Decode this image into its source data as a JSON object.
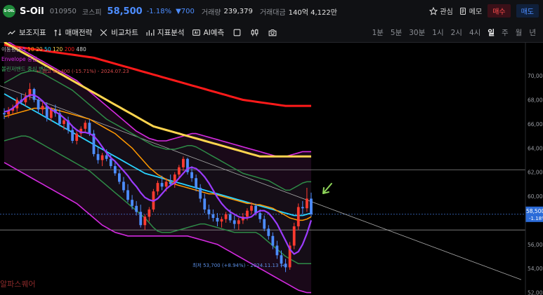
{
  "header": {
    "logo_text": "S-OIL",
    "name": "S-Oil",
    "code": "010950",
    "market": "코스피",
    "price": "58,500",
    "change_pct": "-1.18%",
    "change_abs": "▼700",
    "volume_label": "거래량",
    "volume": "239,379",
    "amount_label": "거래대금",
    "amount": "140억 4,122만",
    "watch": "관심",
    "memo": "메모",
    "buy": "매수",
    "sell": "매도"
  },
  "toolbar": {
    "items": [
      "보조지표",
      "매매전략",
      "비교차트",
      "지표분석",
      "AI예측"
    ],
    "periods": [
      "1분",
      "5분",
      "30분",
      "1시",
      "2시",
      "4시",
      "일",
      "주",
      "월",
      "년"
    ],
    "active_period": "일"
  },
  "legend": {
    "ma_label": "이동평균",
    "ma_periods": [
      "5",
      "10",
      "20",
      "50",
      "120",
      "200",
      "480"
    ],
    "line2": "Envelope 중심",
    "line3": "볼린저밴드 중심 밴드"
  },
  "annotations": {
    "high": "← 최고 69,400 (-15.71%) - 2024.07.23",
    "low": "최저 53,700 (+8.94%) - 2024.11.13 →"
  },
  "price_tag": {
    "price": "58,500",
    "pct": "-1.18%"
  },
  "watermark": "알파스퀘어",
  "colors": {
    "up": "#ff3b30",
    "down": "#4d8dff",
    "ma5": "#9c3cff",
    "ma10": "#ff9800",
    "ma20": "#2ad4ff",
    "ma50": "#ffd54f",
    "ma200": "#ff1a1a",
    "ma480": "#d2d2d2",
    "bb": "#2e8b47",
    "envelope": "#d42ae0"
  },
  "chart_data": {
    "type": "candlestick",
    "y_range": [
      51800,
      72800
    ],
    "y_ticks": [
      "70,000",
      "68,000",
      "66,000",
      "64,000",
      "62,000",
      "60,000",
      "56,000",
      "54,000",
      "52,000"
    ],
    "y_tick_values": [
      70000,
      68000,
      66000,
      64000,
      62000,
      60000,
      56000,
      54000,
      52000
    ],
    "last_price": 58500,
    "reference_lines": [
      62200,
      57200
    ],
    "trendline": {
      "from": [
        0,
        68700
      ],
      "to": [
        1,
        54000
      ]
    },
    "candles": [
      [
        66900,
        67300,
        66400,
        66800
      ],
      [
        66800,
        67400,
        66500,
        67100
      ],
      [
        67100,
        67600,
        66800,
        67300
      ],
      [
        67300,
        68200,
        67000,
        68000
      ],
      [
        68000,
        68500,
        67600,
        67800
      ],
      [
        67800,
        68600,
        67500,
        68300
      ],
      [
        68300,
        69400,
        68000,
        68900
      ],
      [
        68900,
        69000,
        67800,
        68000
      ],
      [
        68000,
        68100,
        66900,
        67200
      ],
      [
        67200,
        67800,
        66800,
        67500
      ],
      [
        67500,
        67800,
        66200,
        66500
      ],
      [
        66500,
        67400,
        66200,
        67200
      ],
      [
        67200,
        67600,
        66600,
        66900
      ],
      [
        66900,
        67200,
        65800,
        66000
      ],
      [
        66000,
        66500,
        65500,
        66300
      ],
      [
        66300,
        66600,
        65200,
        65500
      ],
      [
        65500,
        65900,
        64400,
        64600
      ],
      [
        64600,
        65400,
        64300,
        65200
      ],
      [
        65200,
        65800,
        64900,
        65600
      ],
      [
        65600,
        66300,
        65300,
        66100
      ],
      [
        66100,
        66400,
        65000,
        65200
      ],
      [
        65200,
        65500,
        63300,
        63500
      ],
      [
        63500,
        64100,
        62700,
        63000
      ],
      [
        63000,
        63600,
        62500,
        63400
      ],
      [
        63400,
        63900,
        62900,
        63100
      ],
      [
        63100,
        63500,
        62300,
        62500
      ],
      [
        62500,
        62900,
        61700,
        61900
      ],
      [
        61900,
        62200,
        61000,
        61200
      ],
      [
        61200,
        61600,
        60300,
        60500
      ],
      [
        60500,
        61000,
        59500,
        59700
      ],
      [
        59700,
        60100,
        58900,
        59200
      ],
      [
        59200,
        59600,
        58400,
        58700
      ],
      [
        58700,
        59300,
        57400,
        57600
      ],
      [
        57600,
        58500,
        57200,
        58300
      ],
      [
        58300,
        59100,
        57900,
        58900
      ],
      [
        58900,
        60600,
        58700,
        60400
      ],
      [
        60400,
        61300,
        60100,
        61100
      ],
      [
        61100,
        61700,
        60500,
        60800
      ],
      [
        60800,
        61500,
        60400,
        61200
      ],
      [
        61200,
        61800,
        60800,
        61000
      ],
      [
        61000,
        62000,
        60700,
        61800
      ],
      [
        61800,
        62600,
        61500,
        62400
      ],
      [
        62400,
        63300,
        62100,
        63100
      ],
      [
        63100,
        63200,
        61800,
        62000
      ],
      [
        62000,
        62500,
        61200,
        61500
      ],
      [
        61500,
        61800,
        60400,
        60700
      ],
      [
        60700,
        61000,
        59500,
        59800
      ],
      [
        59800,
        60200,
        58600,
        58900
      ],
      [
        58900,
        59300,
        58100,
        58500
      ],
      [
        58500,
        58900,
        57900,
        58200
      ],
      [
        58200,
        58600,
        57500,
        57900
      ],
      [
        57900,
        58300,
        57400,
        58100
      ],
      [
        58100,
        58700,
        57800,
        58500
      ],
      [
        58500,
        58900,
        57800,
        58000
      ],
      [
        58000,
        58400,
        57300,
        57700
      ],
      [
        57700,
        58200,
        57200,
        58000
      ],
      [
        58000,
        58600,
        57700,
        58300
      ],
      [
        58300,
        59000,
        58000,
        58800
      ],
      [
        58800,
        59500,
        58500,
        59200
      ],
      [
        59200,
        59400,
        58400,
        58600
      ],
      [
        58600,
        58900,
        57800,
        58100
      ],
      [
        58100,
        58400,
        57100,
        57300
      ],
      [
        57300,
        57600,
        56400,
        56700
      ],
      [
        56700,
        57000,
        55600,
        55900
      ],
      [
        55900,
        56300,
        54800,
        55100
      ],
      [
        55100,
        55500,
        54100,
        54400
      ],
      [
        54400,
        54800,
        53700,
        54100
      ],
      [
        54100,
        56200,
        53900,
        55900
      ],
      [
        55900,
        57800,
        55600,
        57500
      ],
      [
        57500,
        59400,
        57200,
        59100
      ],
      [
        59100,
        59600,
        58500,
        59000
      ],
      [
        59000,
        60700,
        58700,
        59800
      ],
      [
        59800,
        60300,
        58300,
        58500
      ]
    ],
    "moving_averages": {
      "ma5": [
        67000,
        67100,
        67300,
        67600,
        67900,
        68200,
        68400,
        68400,
        68200,
        67900,
        67500,
        67200,
        67000,
        66800,
        66500,
        66200,
        65800,
        65500,
        65300,
        65300,
        65200,
        65000,
        64600,
        64100,
        63600,
        63200,
        62900,
        62500,
        62100,
        61700,
        61200,
        60800,
        60300,
        59900,
        59700,
        59600,
        59800,
        60200,
        60600,
        60900,
        61100,
        61500,
        61900,
        62300,
        62400,
        62300,
        62000,
        61600,
        61100,
        60500,
        59900,
        59400,
        59000,
        58700,
        58500,
        58300,
        58200,
        58200,
        58300,
        58600,
        58800,
        58800,
        58600,
        58200,
        57700,
        57000,
        56300,
        55600,
        55200,
        55400,
        56000,
        56900,
        58000
      ],
      "ma20": [
        66600,
        66700,
        66800,
        66900,
        67000,
        67100,
        67200,
        67300,
        67300,
        67300,
        67300,
        67300,
        67200,
        67100,
        67000,
        66900,
        66800,
        66700,
        66600,
        66500,
        66400,
        66200,
        66000,
        65800,
        65600,
        65400,
        65200,
        64900,
        64600,
        64300,
        64000,
        63600,
        63200,
        62800,
        62400,
        62100,
        61800,
        61600,
        61400,
        61200,
        61000,
        60900,
        60800,
        60700,
        60600,
        60500,
        60400,
        60300,
        60200,
        60200,
        60100,
        60000,
        59900,
        59800,
        59700,
        59600,
        59500,
        59400,
        59400,
        59300,
        59300,
        59200,
        59100,
        59000,
        58800,
        58600,
        58400,
        58200,
        58100,
        58000,
        58000,
        58100,
        58300
      ],
      "ma50": [
        68500,
        68300,
        68100,
        67900,
        67700,
        67500,
        67300,
        67100,
        66900,
        66700,
        66500,
        66300,
        66100,
        65900,
        65700,
        65500,
        65300,
        65100,
        64900,
        64700,
        64500,
        64300,
        64100,
        63900,
        63700,
        63500,
        63300,
        63100,
        62900,
        62700,
        62500,
        62300,
        62100,
        61900,
        61800,
        61700,
        61600,
        61500,
        61400,
        61300,
        61200,
        61100,
        61000,
        60900,
        60800,
        60700,
        60600,
        60500,
        60400,
        60300,
        60200,
        60100,
        60000,
        59900,
        59800,
        59700,
        59600,
        59500,
        59400,
        59300,
        59200,
        59100,
        59000,
        58900,
        58800,
        58700,
        58600,
        58500,
        58400,
        58400,
        58400,
        58500,
        58600
      ],
      "ma120": [
        72800,
        72600,
        72400,
        72200,
        72000,
        71800,
        71600,
        71400,
        71200,
        71000,
        70800,
        70600,
        70400,
        70200,
        70000,
        69800,
        69600,
        69400,
        69200,
        69000,
        68800,
        68600,
        68400,
        68200,
        68000,
        67800,
        67600,
        67400,
        67200,
        67000,
        66800,
        66600,
        66400,
        66200,
        66000,
        65800,
        65700,
        65600,
        65500,
        65400,
        65300,
        65200,
        65100,
        65000,
        64900,
        64800,
        64700,
        64600,
        64500,
        64400,
        64300,
        64200,
        64100,
        64000,
        63900,
        63800,
        63700,
        63600,
        63500,
        63400,
        63300,
        63300,
        63300,
        63300,
        63300,
        63300,
        63300,
        63300,
        63300,
        63300,
        63300,
        63300,
        63300
      ],
      "ma200": [
        72600,
        72500,
        72450,
        72400,
        72350,
        72300,
        72250,
        72200,
        72150,
        72100,
        72050,
        72000,
        71950,
        71900,
        71850,
        71800,
        71750,
        71700,
        71650,
        71600,
        71550,
        71500,
        71400,
        71300,
        71200,
        71100,
        71000,
        70900,
        70800,
        70700,
        70600,
        70500,
        70400,
        70300,
        70200,
        70100,
        70000,
        69900,
        69800,
        69700,
        69600,
        69500,
        69400,
        69300,
        69200,
        69100,
        69000,
        68900,
        68800,
        68700,
        68600,
        68500,
        68400,
        68300,
        68200,
        68100,
        68000,
        67950,
        67900,
        67850,
        67800,
        67750,
        67700,
        67650,
        67600,
        67550,
        67500,
        67500,
        67500,
        67500,
        67500,
        67500,
        67500
      ]
    },
    "bollinger": {
      "upper": [
        69400,
        69600,
        69800,
        70000,
        70200,
        70300,
        70400,
        70400,
        70300,
        70200,
        70000,
        69800,
        69600,
        69400,
        69200,
        69000,
        68800,
        68500,
        68200,
        67900,
        67600,
        67300,
        67000,
        66700,
        66400,
        66200,
        66000,
        65800,
        65600,
        65400,
        65200,
        65000,
        64800,
        64600,
        64400,
        64200,
        64100,
        64000,
        63900,
        63900,
        63900,
        64000,
        64100,
        64200,
        64200,
        64100,
        63900,
        63700,
        63500,
        63300,
        63100,
        62900,
        62700,
        62500,
        62300,
        62100,
        61900,
        61800,
        61700,
        61600,
        61500,
        61400,
        61300,
        61100,
        60900,
        60700,
        60500,
        60500,
        60700,
        60900,
        61100,
        61200,
        61200
      ],
      "lower": [
        64600,
        64700,
        64800,
        64900,
        65000,
        65000,
        64900,
        64700,
        64500,
        64300,
        64100,
        63900,
        63700,
        63500,
        63300,
        63100,
        62900,
        62700,
        62500,
        62300,
        62100,
        61800,
        61500,
        61200,
        60900,
        60600,
        60300,
        60000,
        59700,
        59400,
        59100,
        58800,
        58500,
        58200,
        57800,
        57400,
        57100,
        57000,
        57000,
        57000,
        57100,
        57200,
        57300,
        57400,
        57500,
        57600,
        57700,
        57700,
        57600,
        57500,
        57400,
        57300,
        57200,
        57100,
        57000,
        57000,
        57000,
        57000,
        57000,
        57000,
        56800,
        56500,
        56200,
        55900,
        55600,
        55300,
        55000,
        54800,
        54600,
        54400,
        54400,
        54400,
        54400
      ]
    },
    "envelope": {
      "upper": [
        73000,
        72800,
        72600,
        72400,
        72200,
        72000,
        71800,
        71600,
        71400,
        71200,
        71000,
        70800,
        70600,
        70400,
        70200,
        70000,
        69800,
        69600,
        69300,
        69000,
        68700,
        68400,
        68100,
        67800,
        67500,
        67200,
        66900,
        66600,
        66300,
        66000,
        65700,
        65400,
        65200,
        65000,
        64800,
        64700,
        64600,
        64600,
        64600,
        64700,
        64800,
        64900,
        65000,
        65100,
        65200,
        65200,
        65100,
        65000,
        64900,
        64800,
        64700,
        64600,
        64500,
        64400,
        64300,
        64200,
        64100,
        64000,
        63900,
        63800,
        63700,
        63600,
        63500,
        63400,
        63300,
        63300,
        63300,
        63400,
        63500,
        63600,
        63700,
        63700,
        63700
      ],
      "lower": [
        62800,
        62600,
        62400,
        62200,
        62000,
        61800,
        61600,
        61400,
        61200,
        61000,
        60800,
        60600,
        60400,
        60200,
        60000,
        59800,
        59600,
        59400,
        59100,
        58800,
        58500,
        58200,
        57900,
        57600,
        57400,
        57200,
        57000,
        56900,
        56800,
        56700,
        56700,
        56700,
        56700,
        56700,
        56700,
        56700,
        56700,
        56700,
        56700,
        56700,
        56700,
        56700,
        56700,
        56700,
        56600,
        56500,
        56400,
        56300,
        56200,
        56100,
        56000,
        55800,
        55600,
        55400,
        55200,
        55000,
        54800,
        54600,
        54400,
        54200,
        54000,
        53800,
        53600,
        53400,
        53200,
        53000,
        52800,
        52600,
        52400,
        52200,
        52100,
        52000,
        52000
      ]
    }
  }
}
